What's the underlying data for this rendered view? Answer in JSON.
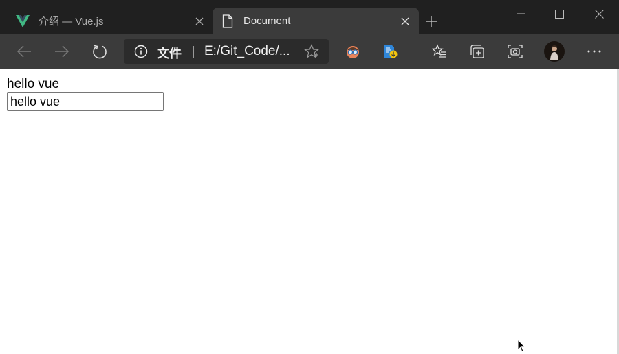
{
  "browser": {
    "tabs": [
      {
        "title": "介绍 — Vue.js",
        "favicon": "vue-logo-icon",
        "active": false
      },
      {
        "title": "Document",
        "favicon": "document-icon",
        "active": true
      }
    ],
    "address_bar": {
      "security_label": "文件",
      "url": "E:/Git_Code/..."
    },
    "colors": {
      "tabstrip": "#202020",
      "toolbar": "#3b3b3b",
      "address_bg": "#2b2b2b",
      "vue_green": "#41b883",
      "vue_dark": "#35495e"
    }
  },
  "page": {
    "message": "hello vue",
    "input_value": "hello vue"
  }
}
